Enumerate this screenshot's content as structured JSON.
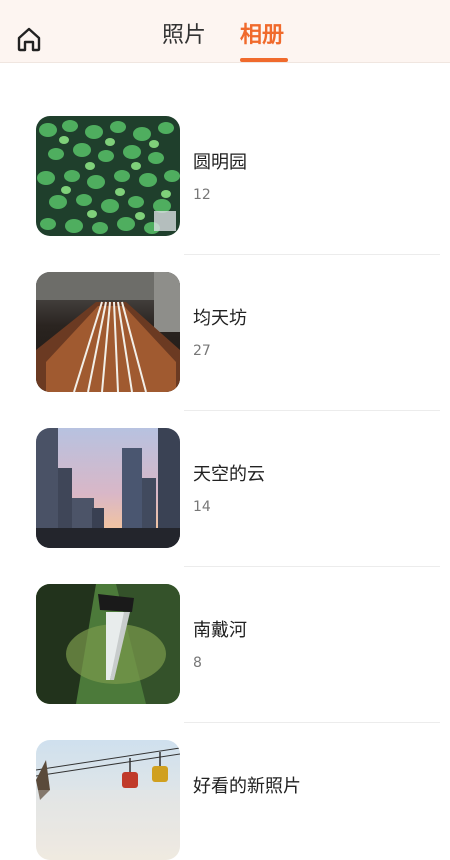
{
  "header": {
    "tabs": [
      {
        "label": "照片",
        "active": false
      },
      {
        "label": "相册",
        "active": true
      }
    ],
    "accent_color": "#f06a2c",
    "home_icon": "home-icon"
  },
  "albums": [
    {
      "title": "圆明园",
      "count": "12"
    },
    {
      "title": "均天坊",
      "count": "27"
    },
    {
      "title": "天空的云",
      "count": "14"
    },
    {
      "title": "南戴河",
      "count": "8"
    },
    {
      "title": "好看的新照片",
      "count": ""
    }
  ]
}
